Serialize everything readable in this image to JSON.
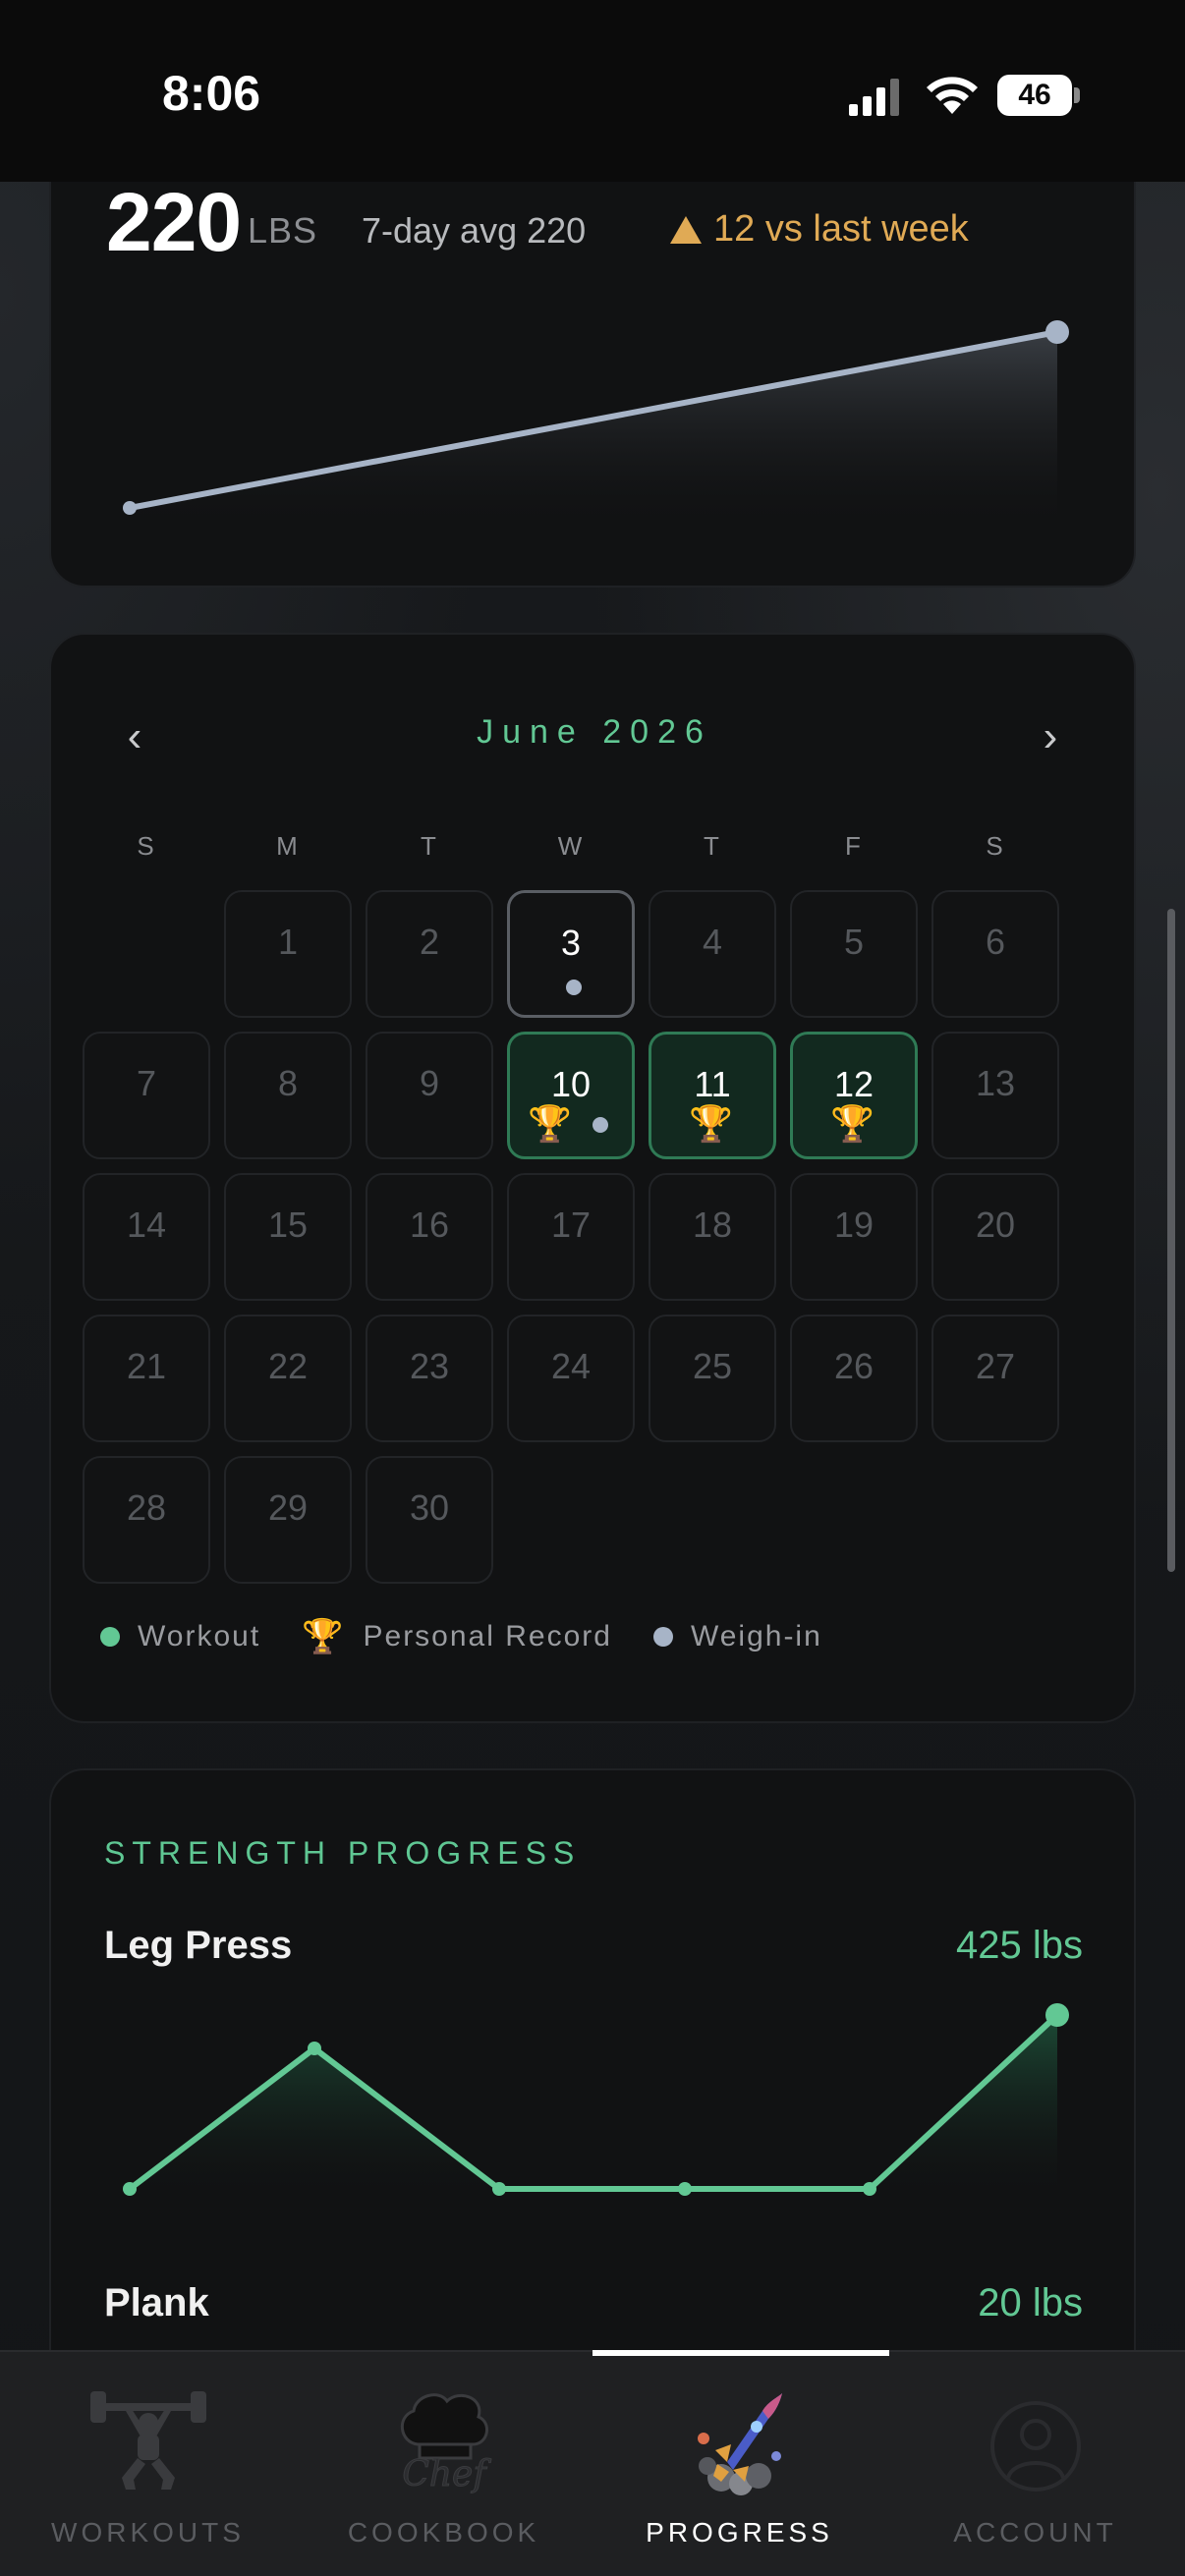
{
  "status_bar": {
    "time": "8:06",
    "battery": "46"
  },
  "weight": {
    "value": "220",
    "unit": "LBS",
    "avg": "7-day avg 220",
    "change": "12 vs last week",
    "change_color": "#e0aa55",
    "line_color": "#a7b4c7"
  },
  "calendar": {
    "month": "June 2026",
    "prev_icon": "chevron-left-icon",
    "next_icon": "chevron-right-icon",
    "weekdays": [
      "S",
      "M",
      "T",
      "W",
      "T",
      "F",
      "S"
    ],
    "days": [
      {
        "n": "1"
      },
      {
        "n": "2"
      },
      {
        "n": "3",
        "today": true,
        "weigh_in": true
      },
      {
        "n": "4"
      },
      {
        "n": "5"
      },
      {
        "n": "6"
      },
      {
        "n": "7"
      },
      {
        "n": "8"
      },
      {
        "n": "9"
      },
      {
        "n": "10",
        "pr": true,
        "weigh_in": true
      },
      {
        "n": "11",
        "pr": true
      },
      {
        "n": "12",
        "pr": true
      },
      {
        "n": "13"
      },
      {
        "n": "14"
      },
      {
        "n": "15"
      },
      {
        "n": "16"
      },
      {
        "n": "17"
      },
      {
        "n": "18"
      },
      {
        "n": "19"
      },
      {
        "n": "20"
      },
      {
        "n": "21"
      },
      {
        "n": "22"
      },
      {
        "n": "23"
      },
      {
        "n": "24"
      },
      {
        "n": "25"
      },
      {
        "n": "26"
      },
      {
        "n": "27"
      },
      {
        "n": "28"
      },
      {
        "n": "29"
      },
      {
        "n": "30"
      }
    ],
    "legend": {
      "workout": "Workout",
      "pr": "Personal Record",
      "weigh_in": "Weigh-in",
      "workout_color": "#62c894",
      "weigh_in_color": "#a7b4c7"
    }
  },
  "strength": {
    "title": "STRENGTH PROGRESS",
    "exercises": [
      {
        "name": "Leg Press",
        "value": "425 lbs"
      },
      {
        "name": "Plank",
        "value": "20 lbs"
      }
    ],
    "accent": "#62c894"
  },
  "tabs": [
    {
      "label": "WORKOUTS",
      "icon": "weightlifter-icon",
      "active": false
    },
    {
      "label": "COOKBOOK",
      "icon": "chef-hat-icon",
      "active": false
    },
    {
      "label": "PROGRESS",
      "icon": "rocket-icon",
      "active": true
    },
    {
      "label": "ACCOUNT",
      "icon": "account-icon",
      "active": false
    }
  ]
}
